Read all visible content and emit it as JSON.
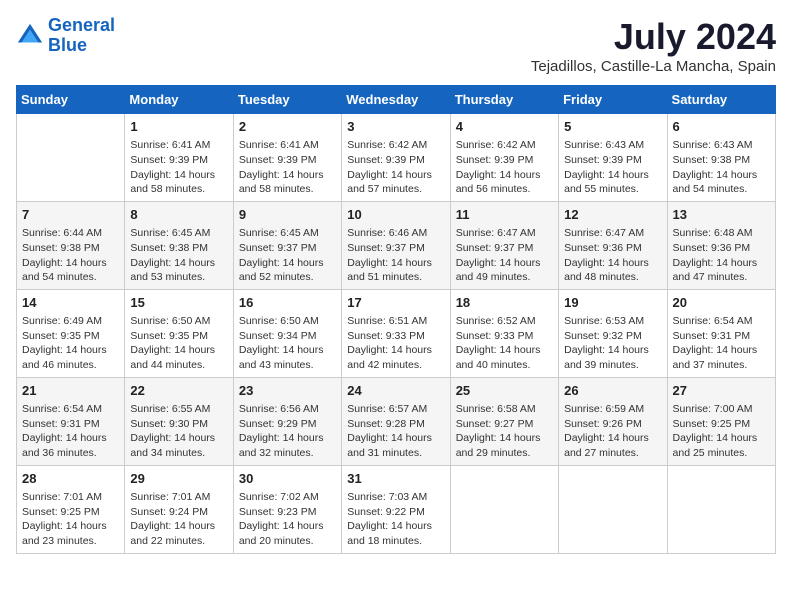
{
  "header": {
    "logo_line1": "General",
    "logo_line2": "Blue",
    "month": "July 2024",
    "location": "Tejadillos, Castille-La Mancha, Spain"
  },
  "days_of_week": [
    "Sunday",
    "Monday",
    "Tuesday",
    "Wednesday",
    "Thursday",
    "Friday",
    "Saturday"
  ],
  "weeks": [
    [
      {
        "day": "",
        "info": ""
      },
      {
        "day": "1",
        "info": "Sunrise: 6:41 AM\nSunset: 9:39 PM\nDaylight: 14 hours\nand 58 minutes."
      },
      {
        "day": "2",
        "info": "Sunrise: 6:41 AM\nSunset: 9:39 PM\nDaylight: 14 hours\nand 58 minutes."
      },
      {
        "day": "3",
        "info": "Sunrise: 6:42 AM\nSunset: 9:39 PM\nDaylight: 14 hours\nand 57 minutes."
      },
      {
        "day": "4",
        "info": "Sunrise: 6:42 AM\nSunset: 9:39 PM\nDaylight: 14 hours\nand 56 minutes."
      },
      {
        "day": "5",
        "info": "Sunrise: 6:43 AM\nSunset: 9:39 PM\nDaylight: 14 hours\nand 55 minutes."
      },
      {
        "day": "6",
        "info": "Sunrise: 6:43 AM\nSunset: 9:38 PM\nDaylight: 14 hours\nand 54 minutes."
      }
    ],
    [
      {
        "day": "7",
        "info": "Sunrise: 6:44 AM\nSunset: 9:38 PM\nDaylight: 14 hours\nand 54 minutes."
      },
      {
        "day": "8",
        "info": "Sunrise: 6:45 AM\nSunset: 9:38 PM\nDaylight: 14 hours\nand 53 minutes."
      },
      {
        "day": "9",
        "info": "Sunrise: 6:45 AM\nSunset: 9:37 PM\nDaylight: 14 hours\nand 52 minutes."
      },
      {
        "day": "10",
        "info": "Sunrise: 6:46 AM\nSunset: 9:37 PM\nDaylight: 14 hours\nand 51 minutes."
      },
      {
        "day": "11",
        "info": "Sunrise: 6:47 AM\nSunset: 9:37 PM\nDaylight: 14 hours\nand 49 minutes."
      },
      {
        "day": "12",
        "info": "Sunrise: 6:47 AM\nSunset: 9:36 PM\nDaylight: 14 hours\nand 48 minutes."
      },
      {
        "day": "13",
        "info": "Sunrise: 6:48 AM\nSunset: 9:36 PM\nDaylight: 14 hours\nand 47 minutes."
      }
    ],
    [
      {
        "day": "14",
        "info": "Sunrise: 6:49 AM\nSunset: 9:35 PM\nDaylight: 14 hours\nand 46 minutes."
      },
      {
        "day": "15",
        "info": "Sunrise: 6:50 AM\nSunset: 9:35 PM\nDaylight: 14 hours\nand 44 minutes."
      },
      {
        "day": "16",
        "info": "Sunrise: 6:50 AM\nSunset: 9:34 PM\nDaylight: 14 hours\nand 43 minutes."
      },
      {
        "day": "17",
        "info": "Sunrise: 6:51 AM\nSunset: 9:33 PM\nDaylight: 14 hours\nand 42 minutes."
      },
      {
        "day": "18",
        "info": "Sunrise: 6:52 AM\nSunset: 9:33 PM\nDaylight: 14 hours\nand 40 minutes."
      },
      {
        "day": "19",
        "info": "Sunrise: 6:53 AM\nSunset: 9:32 PM\nDaylight: 14 hours\nand 39 minutes."
      },
      {
        "day": "20",
        "info": "Sunrise: 6:54 AM\nSunset: 9:31 PM\nDaylight: 14 hours\nand 37 minutes."
      }
    ],
    [
      {
        "day": "21",
        "info": "Sunrise: 6:54 AM\nSunset: 9:31 PM\nDaylight: 14 hours\nand 36 minutes."
      },
      {
        "day": "22",
        "info": "Sunrise: 6:55 AM\nSunset: 9:30 PM\nDaylight: 14 hours\nand 34 minutes."
      },
      {
        "day": "23",
        "info": "Sunrise: 6:56 AM\nSunset: 9:29 PM\nDaylight: 14 hours\nand 32 minutes."
      },
      {
        "day": "24",
        "info": "Sunrise: 6:57 AM\nSunset: 9:28 PM\nDaylight: 14 hours\nand 31 minutes."
      },
      {
        "day": "25",
        "info": "Sunrise: 6:58 AM\nSunset: 9:27 PM\nDaylight: 14 hours\nand 29 minutes."
      },
      {
        "day": "26",
        "info": "Sunrise: 6:59 AM\nSunset: 9:26 PM\nDaylight: 14 hours\nand 27 minutes."
      },
      {
        "day": "27",
        "info": "Sunrise: 7:00 AM\nSunset: 9:25 PM\nDaylight: 14 hours\nand 25 minutes."
      }
    ],
    [
      {
        "day": "28",
        "info": "Sunrise: 7:01 AM\nSunset: 9:25 PM\nDaylight: 14 hours\nand 23 minutes."
      },
      {
        "day": "29",
        "info": "Sunrise: 7:01 AM\nSunset: 9:24 PM\nDaylight: 14 hours\nand 22 minutes."
      },
      {
        "day": "30",
        "info": "Sunrise: 7:02 AM\nSunset: 9:23 PM\nDaylight: 14 hours\nand 20 minutes."
      },
      {
        "day": "31",
        "info": "Sunrise: 7:03 AM\nSunset: 9:22 PM\nDaylight: 14 hours\nand 18 minutes."
      },
      {
        "day": "",
        "info": ""
      },
      {
        "day": "",
        "info": ""
      },
      {
        "day": "",
        "info": ""
      }
    ]
  ]
}
